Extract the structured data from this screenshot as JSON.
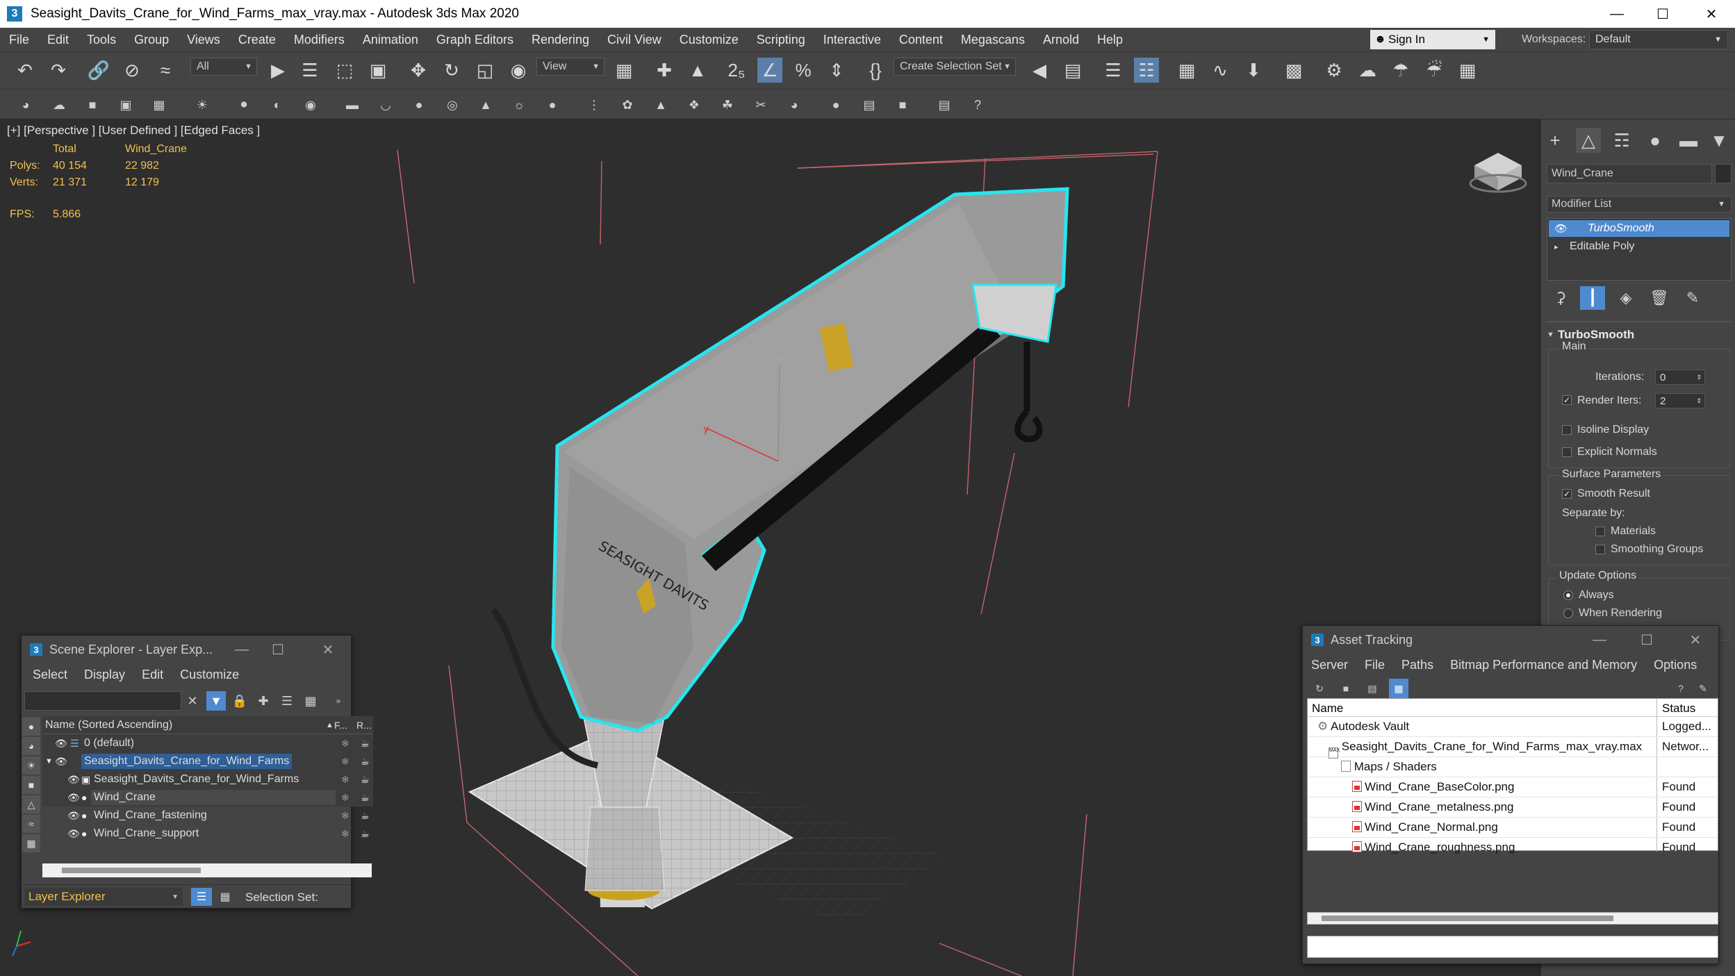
{
  "window": {
    "title": "Seasight_Davits_Crane_for_Wind_Farms_max_vray.max - Autodesk 3ds Max 2020",
    "app_icon": "3"
  },
  "menu": [
    "File",
    "Edit",
    "Tools",
    "Group",
    "Views",
    "Create",
    "Modifiers",
    "Animation",
    "Graph Editors",
    "Rendering",
    "Civil View",
    "Customize",
    "Scripting",
    "Interactive",
    "Content",
    "Megascans",
    "Arnold",
    "Help"
  ],
  "signin": {
    "label": "Sign In"
  },
  "workspaces": {
    "label": "Workspaces:",
    "value": "Default"
  },
  "toolbar": {
    "filter": "All",
    "ref_coord": "View",
    "selection_set": "Create Selection Set"
  },
  "viewport": {
    "label": "[+] [Perspective ] [User Defined ] [Edged Faces ]",
    "stats_header": [
      "Total",
      "Wind_Crane"
    ],
    "polys": {
      "label": "Polys:",
      "total": "40 154",
      "sel": "22 982"
    },
    "verts": {
      "label": "Verts:",
      "total": "21 371",
      "sel": "12 179"
    },
    "fps": {
      "label": "FPS:",
      "value": "5.866"
    },
    "axes": {
      "x": "x",
      "y": "y",
      "z": "z"
    }
  },
  "command_panel": {
    "object_name": "Wind_Crane",
    "modifier_list": "Modifier List",
    "stack": [
      "TurboSmooth",
      "Editable Poly"
    ],
    "rollout": "TurboSmooth",
    "main": "Main",
    "iterations": {
      "label": "Iterations:",
      "value": "0"
    },
    "render_iters": {
      "label": "Render Iters:",
      "value": "2"
    },
    "isoline": "Isoline Display",
    "explicit_normals": "Explicit Normals",
    "surface_params": "Surface Parameters",
    "smooth_result": "Smooth Result",
    "separate_by": "Separate by:",
    "materials": "Materials",
    "smoothing_groups": "Smoothing Groups",
    "update_options": "Update Options",
    "always": "Always",
    "when_rendering": "When Rendering"
  },
  "scene_explorer": {
    "title": "Scene Explorer - Layer Exp...",
    "menu": [
      "Select",
      "Display",
      "Edit",
      "Customize"
    ],
    "col_name": "Name (Sorted Ascending)",
    "col_f": "F...",
    "col_r": "R...",
    "rows": [
      {
        "name": "0 (default)"
      },
      {
        "name": "Seasight_Davits_Crane_for_Wind_Farms"
      },
      {
        "name": "Seasight_Davits_Crane_for_Wind_Farms"
      },
      {
        "name": "Wind_Crane"
      },
      {
        "name": "Wind_Crane_fastening"
      },
      {
        "name": "Wind_Crane_support"
      }
    ],
    "footer_dropdown": "Layer Explorer",
    "selection_set": "Selection Set:"
  },
  "asset_tracking": {
    "title": "Asset Tracking",
    "menu": [
      "Server",
      "File",
      "Paths",
      "Bitmap Performance and Memory",
      "Options"
    ],
    "col_name": "Name",
    "col_status": "Status",
    "rows": [
      {
        "name": "Autodesk Vault",
        "status": "Logged..."
      },
      {
        "name": "Seasight_Davits_Crane_for_Wind_Farms_max_vray.max",
        "status": "Networ..."
      },
      {
        "name": "Maps / Shaders",
        "status": ""
      },
      {
        "name": "Wind_Crane_BaseColor.png",
        "status": "Found"
      },
      {
        "name": "Wind_Crane_metalness.png",
        "status": "Found"
      },
      {
        "name": "Wind_Crane_Normal.png",
        "status": "Found"
      },
      {
        "name": "Wind_Crane_roughness.png",
        "status": "Found"
      }
    ]
  },
  "crane_decal_text": "SEASIGHT DAVITS"
}
